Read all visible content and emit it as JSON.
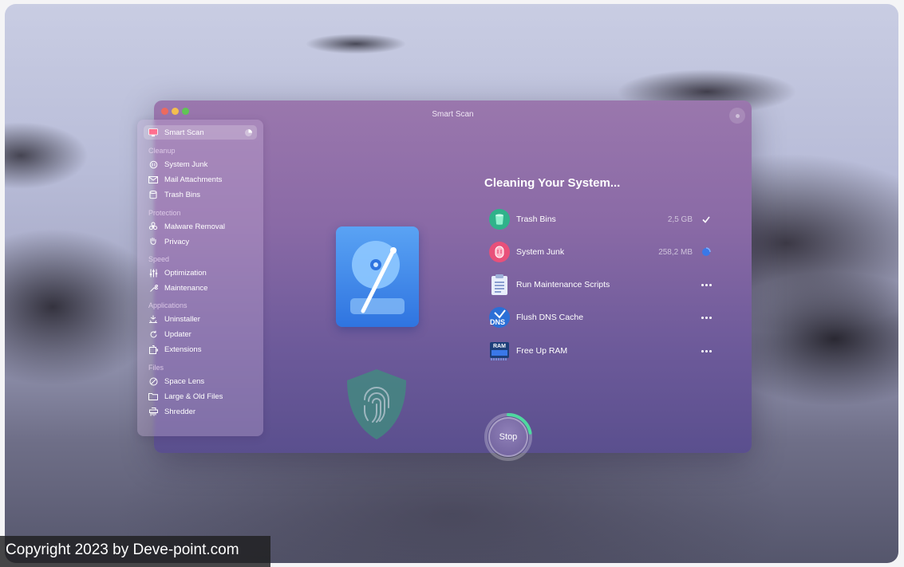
{
  "window": {
    "title": "Smart Scan"
  },
  "sidebar": {
    "active": {
      "label": "Smart Scan"
    },
    "sections": [
      {
        "heading": "Cleanup",
        "items": [
          "System Junk",
          "Mail Attachments",
          "Trash Bins"
        ]
      },
      {
        "heading": "Protection",
        "items": [
          "Malware Removal",
          "Privacy"
        ]
      },
      {
        "heading": "Speed",
        "items": [
          "Optimization",
          "Maintenance"
        ]
      },
      {
        "heading": "Applications",
        "items": [
          "Uninstaller",
          "Updater",
          "Extensions"
        ]
      },
      {
        "heading": "Files",
        "items": [
          "Space Lens",
          "Large & Old Files",
          "Shredder"
        ]
      }
    ]
  },
  "main": {
    "heading": "Cleaning Your System...",
    "tasks": [
      {
        "name": "Trash Bins",
        "size": "2,5 GB",
        "status": "done",
        "icon": "trash-bin-icon"
      },
      {
        "name": "System Junk",
        "size": "258,2 MB",
        "status": "in-progress",
        "icon": "system-junk-icon"
      },
      {
        "name": "Run Maintenance Scripts",
        "size": "",
        "status": "pending",
        "icon": "clipboard-icon"
      },
      {
        "name": "Flush DNS Cache",
        "size": "",
        "status": "pending",
        "icon": "dns-icon",
        "icon_text": "DNS"
      },
      {
        "name": "Free Up RAM",
        "size": "",
        "status": "pending",
        "icon": "ram-icon",
        "icon_text": "RAM"
      }
    ],
    "stop_label": "Stop",
    "scan_progress": 0.22
  },
  "footer": {
    "copyright": "Copyright 2023 by Deve-point.com"
  },
  "colors": {
    "accent_green": "#4fd8a0",
    "window_top": "#9a77ad",
    "window_bottom": "#5a4f8e"
  }
}
